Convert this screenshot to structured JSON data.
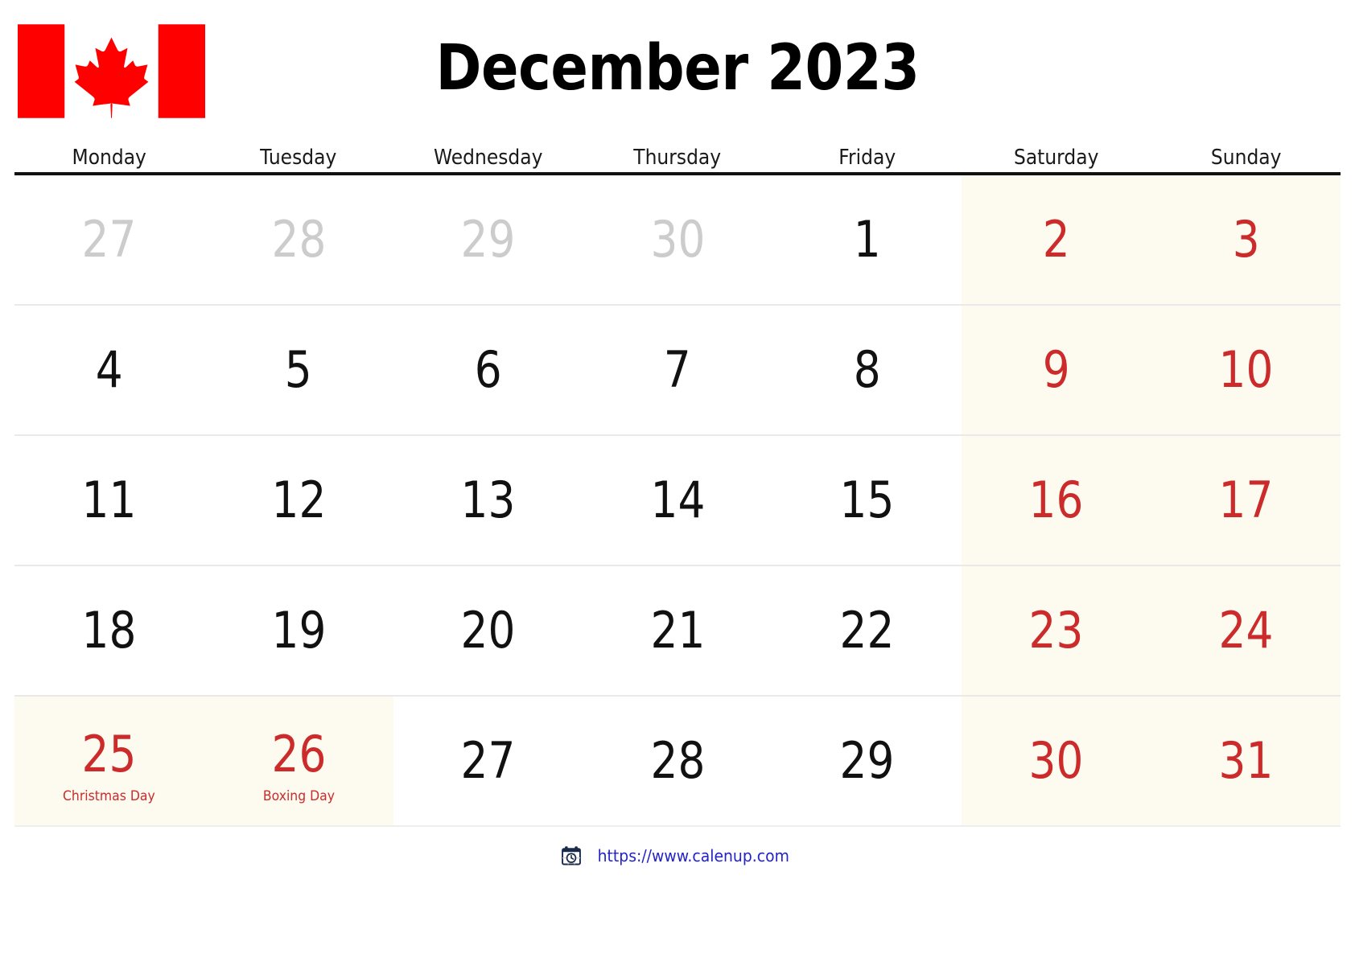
{
  "header": {
    "title": "December 2023",
    "flag_name": "canada-flag",
    "flag_colors": {
      "red": "#FF0000",
      "white": "#FFFFFF"
    }
  },
  "weekdays": [
    "Monday",
    "Tuesday",
    "Wednesday",
    "Thursday",
    "Friday",
    "Saturday",
    "Sunday"
  ],
  "colors": {
    "weekend_bg": "#FDFAEF",
    "weekend_text": "#CC2B2B",
    "holiday_text": "#CC2B2B",
    "muted_text": "#CCCCCC",
    "day_text": "#111111",
    "rule": "#111111",
    "row_separator": "#E9E9E9",
    "link": "#2323C8"
  },
  "weeks": [
    [
      {
        "num": "27",
        "type": "muted"
      },
      {
        "num": "28",
        "type": "muted"
      },
      {
        "num": "29",
        "type": "muted"
      },
      {
        "num": "30",
        "type": "muted"
      },
      {
        "num": "1",
        "type": "day"
      },
      {
        "num": "2",
        "type": "weekend"
      },
      {
        "num": "3",
        "type": "weekend"
      }
    ],
    [
      {
        "num": "4",
        "type": "day"
      },
      {
        "num": "5",
        "type": "day"
      },
      {
        "num": "6",
        "type": "day"
      },
      {
        "num": "7",
        "type": "day"
      },
      {
        "num": "8",
        "type": "day"
      },
      {
        "num": "9",
        "type": "weekend"
      },
      {
        "num": "10",
        "type": "weekend"
      }
    ],
    [
      {
        "num": "11",
        "type": "day"
      },
      {
        "num": "12",
        "type": "day"
      },
      {
        "num": "13",
        "type": "day"
      },
      {
        "num": "14",
        "type": "day"
      },
      {
        "num": "15",
        "type": "day"
      },
      {
        "num": "16",
        "type": "weekend"
      },
      {
        "num": "17",
        "type": "weekend"
      }
    ],
    [
      {
        "num": "18",
        "type": "day"
      },
      {
        "num": "19",
        "type": "day"
      },
      {
        "num": "20",
        "type": "day"
      },
      {
        "num": "21",
        "type": "day"
      },
      {
        "num": "22",
        "type": "day"
      },
      {
        "num": "23",
        "type": "weekend"
      },
      {
        "num": "24",
        "type": "weekend"
      }
    ],
    [
      {
        "num": "25",
        "type": "holiday",
        "holiday": "Christmas Day"
      },
      {
        "num": "26",
        "type": "holiday",
        "holiday": "Boxing Day"
      },
      {
        "num": "27",
        "type": "day"
      },
      {
        "num": "28",
        "type": "day"
      },
      {
        "num": "29",
        "type": "day"
      },
      {
        "num": "30",
        "type": "weekend"
      },
      {
        "num": "31",
        "type": "weekend"
      }
    ]
  ],
  "footer": {
    "icon_name": "calendar-clock-icon",
    "url": "https://www.calenup.com"
  }
}
